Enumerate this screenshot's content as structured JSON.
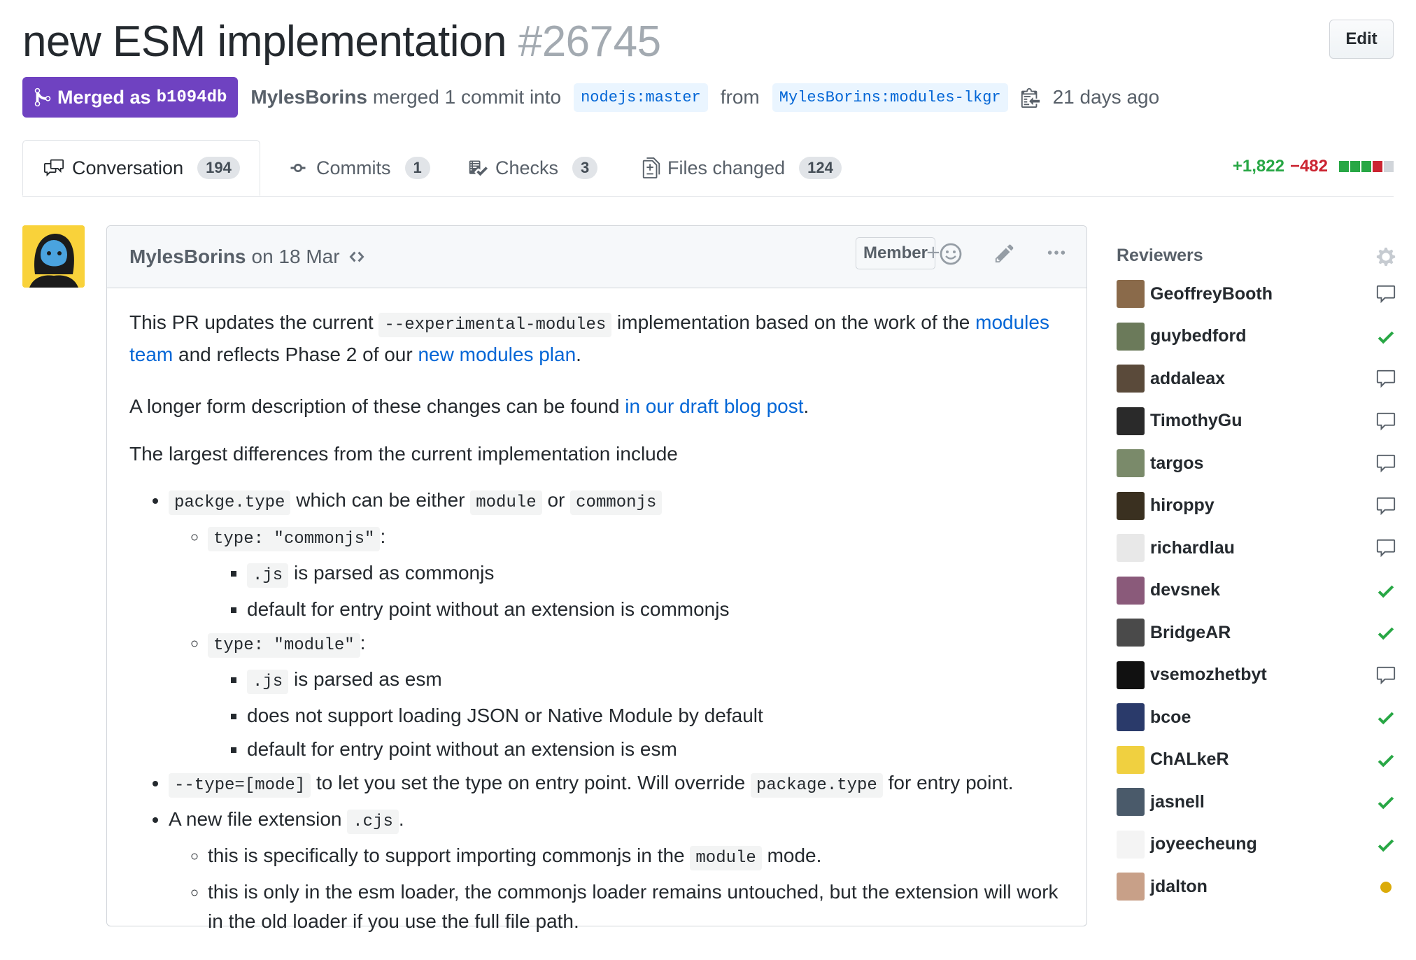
{
  "pr": {
    "title": "new ESM implementation",
    "number": "#26745",
    "edit_label": "Edit",
    "state_label": "Merged as",
    "merge_sha": "b1094db",
    "author": "MylesBorins",
    "merged_text": "merged 1 commit into",
    "base_branch": "nodejs:master",
    "from_text": "from",
    "head_branch": "MylesBorins:modules-lkgr",
    "time_ago": "21 days ago"
  },
  "tabs": [
    {
      "label": "Conversation",
      "count": "194",
      "icon": "comment-discussion-icon"
    },
    {
      "label": "Commits",
      "count": "1",
      "icon": "git-commit-icon"
    },
    {
      "label": "Checks",
      "count": "3",
      "icon": "checklist-icon"
    },
    {
      "label": "Files changed",
      "count": "124",
      "icon": "file-diff-icon"
    }
  ],
  "diffstat": {
    "additions": "+1,822",
    "deletions": "−482",
    "colors": [
      "#28a745",
      "#28a745",
      "#28a745",
      "#cb2431",
      "#d1d5da"
    ]
  },
  "comment": {
    "author": "MylesBorins",
    "date": "on 18 Mar",
    "badge": "Member",
    "p1": {
      "a": "This PR updates the current ",
      "code": "--experimental-modules",
      "b": " implementation based on the work of the ",
      "link1": "modules team",
      "c": " and reflects Phase 2 of our ",
      "link2": "new modules plan",
      "d": "."
    },
    "p2": {
      "a": "A longer form description of these changes can be found ",
      "link": "in our draft blog post",
      "b": "."
    },
    "p3": "The largest differences from the current implementation include",
    "list": {
      "i1": {
        "code": "packge.type",
        "a": " which can be either ",
        "c1": "module",
        "b": " or ",
        "c2": "commonjs"
      },
      "i1a": {
        "code": "type: \"commonjs\"",
        "a": ":"
      },
      "i1a1": {
        "code": ".js",
        "a": " is parsed as commonjs"
      },
      "i1a2": "default for entry point without an extension is commonjs",
      "i1b": {
        "code": "type: \"module\"",
        "a": ":"
      },
      "i1b1": {
        "code": ".js",
        "a": " is parsed as esm"
      },
      "i1b2": "does not support loading JSON or Native Module by default",
      "i1b3": "default for entry point without an extension is esm",
      "i2": {
        "code": "--type=[mode]",
        "a": " to let you set the type on entry point. Will override ",
        "code2": "package.type",
        "b": " for entry point."
      },
      "i3": {
        "a": "A new file extension ",
        "code": ".cjs",
        "b": "."
      },
      "i3a": {
        "a": "this is specifically to support importing commonjs in the ",
        "code": "module",
        "b": " mode."
      },
      "i3b": "this is only in the esm loader, the commonjs loader remains untouched, but the extension will work in the old loader if you use the full file path."
    }
  },
  "sidebar": {
    "title": "Reviewers",
    "reviewers": [
      {
        "name": "GeoffreyBooth",
        "status": "comment",
        "color": "#8a6a4a"
      },
      {
        "name": "guybedford",
        "status": "approved",
        "color": "#6b7a5a"
      },
      {
        "name": "addaleax",
        "status": "comment",
        "color": "#5a4a3a"
      },
      {
        "name": "TimothyGu",
        "status": "comment",
        "color": "#2a2a2a"
      },
      {
        "name": "targos",
        "status": "comment",
        "color": "#7a8a6a"
      },
      {
        "name": "hiroppy",
        "status": "comment",
        "color": "#3a3020"
      },
      {
        "name": "richardlau",
        "status": "comment",
        "color": "#e8e8e8"
      },
      {
        "name": "devsnek",
        "status": "approved",
        "color": "#8a5a7a"
      },
      {
        "name": "BridgeAR",
        "status": "approved",
        "color": "#4a4a4a"
      },
      {
        "name": "vsemozhetbyt",
        "status": "comment",
        "color": "#111111"
      },
      {
        "name": "bcoe",
        "status": "approved",
        "color": "#2a3a6a"
      },
      {
        "name": "ChALkeR",
        "status": "approved",
        "color": "#f0d040"
      },
      {
        "name": "jasnell",
        "status": "approved",
        "color": "#4a5a6a"
      },
      {
        "name": "joyeecheung",
        "status": "approved",
        "color": "#f4f4f4"
      },
      {
        "name": "jdalton",
        "status": "pending",
        "color": "#c8a088"
      }
    ]
  }
}
